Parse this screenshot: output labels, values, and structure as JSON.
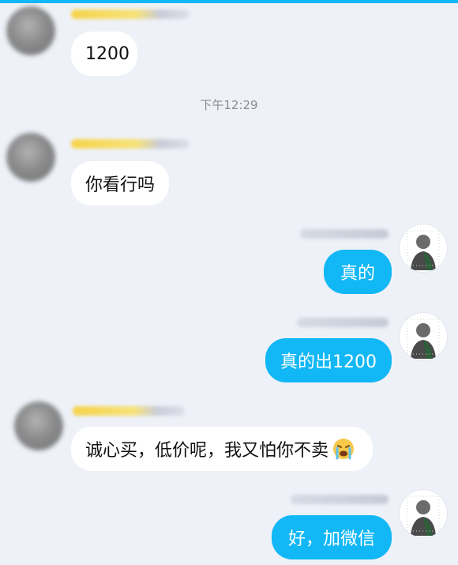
{
  "chat": {
    "timestamp": "下午12:29",
    "messages": [
      {
        "side": "left",
        "text": "1200"
      },
      {
        "side": "left",
        "text": "你看行吗"
      },
      {
        "side": "right",
        "text": "真的"
      },
      {
        "side": "right",
        "text": "真的出1200"
      },
      {
        "side": "left",
        "text": "诚心买，低价呢，我又怕你不卖",
        "emoji": "crying-face"
      },
      {
        "side": "right",
        "text": "好，加微信"
      }
    ]
  },
  "colors": {
    "accent": "#12b7f5",
    "background": "#eef1f7",
    "incoming_bubble": "#ffffff"
  }
}
